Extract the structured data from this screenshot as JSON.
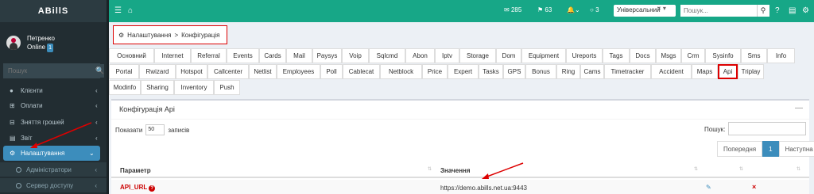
{
  "brand": "ABillS",
  "user": {
    "name": "Петренко",
    "status": "Online",
    "badge": "1"
  },
  "sidebar": {
    "search_placeholder": "Пошук",
    "items": [
      {
        "label": "Клієнти",
        "icon": "user-icon"
      },
      {
        "label": "Оплати",
        "icon": "plus-square-icon"
      },
      {
        "label": "Зняття грошей",
        "icon": "minus-square-icon"
      },
      {
        "label": "Звіт",
        "icon": "chart-icon"
      },
      {
        "label": "Налаштування",
        "icon": "gear-icon"
      }
    ],
    "subitems": [
      {
        "label": "Адміністратори"
      },
      {
        "label": "Сервер доступу"
      }
    ]
  },
  "topbar": {
    "mail_count": "285",
    "flag_count": "63",
    "bell_count": "",
    "chat_count": "3",
    "select_value": "Універсальний",
    "search_placeholder": "Пошук..."
  },
  "breadcrumb": {
    "root": "Налаштування",
    "sep": ">",
    "current": "Конфігурація"
  },
  "tabs": [
    [
      "Основний",
      "Internet",
      "Referral",
      "Events",
      "Cards",
      "Mail",
      "Paysys",
      "Voip",
      "Sqlcmd",
      "Abon",
      "Iptv",
      "Storage",
      "Dom",
      "Equipment",
      "Ureports",
      "Tags",
      "Docs",
      "Msgs",
      "Crm",
      "Sysinfo",
      "Sms",
      "Info"
    ],
    [
      "Portal",
      "Rwizard",
      "Hotspot",
      "Callcenter",
      "Netlist",
      "Employees",
      "Poll",
      "Cablecat",
      "Netblock",
      "Price",
      "Expert",
      "Tasks",
      "GPS",
      "Bonus",
      "Ring",
      "Cams",
      "Timetracker",
      "Accident",
      "Maps",
      "Api",
      "Triplay"
    ],
    [
      "Modinfo",
      "Sharing",
      "Inventory",
      "Push"
    ]
  ],
  "active_tab": "Api",
  "panel": {
    "title": "Конфігурація Api",
    "show_prefix": "Показати",
    "show_value": "50",
    "show_suffix": "записів",
    "search_label": "Пошук:",
    "prev": "Попередня",
    "page": "1",
    "next": "Наступна",
    "col_param": "Параметр",
    "col_value": "Значення",
    "rows": [
      {
        "param": "API_URL",
        "value": "https://demo.abills.net.ua:9443"
      }
    ]
  },
  "colors": {
    "topbar": "#17a787",
    "sidebar": "#222d32",
    "accent": "#3c8dbc",
    "highlight": "#d00000"
  }
}
